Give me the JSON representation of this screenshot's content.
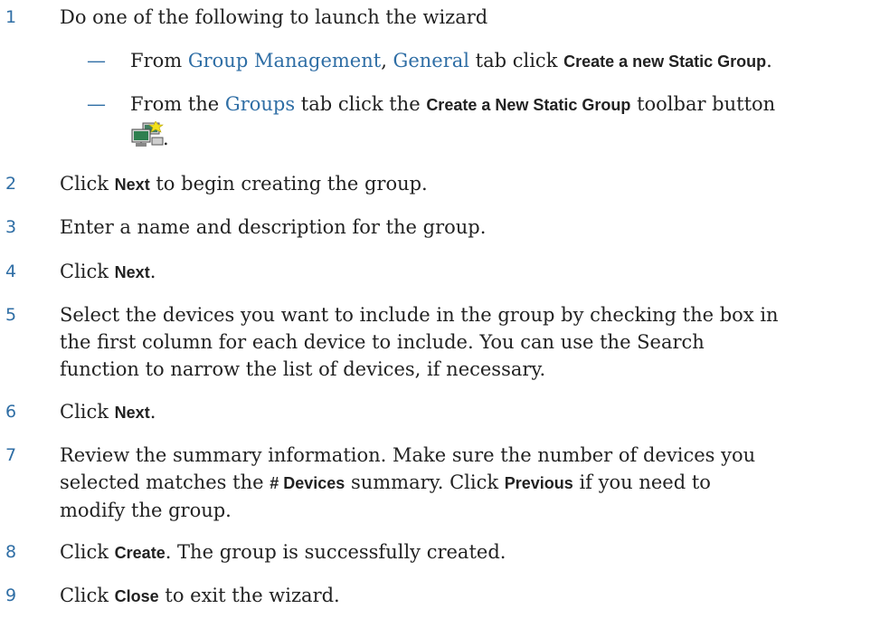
{
  "steps": [
    {
      "num": "1",
      "text": "Do one of the following to launch the wizard"
    },
    {
      "num": "2",
      "pre": "Click ",
      "bold": "Next",
      "post": " to begin creating the group."
    },
    {
      "num": "3",
      "text": "Enter a name and description for the group."
    },
    {
      "num": "4",
      "pre": "Click ",
      "bold": "Next",
      "post": "."
    },
    {
      "num": "5",
      "line1": "Select the devices you want to include in the group by checking the box in",
      "line2": "the first column for each device to include. You can use the Search",
      "line3": "function to narrow the list of devices, if necessary."
    },
    {
      "num": "6",
      "pre": "Click ",
      "bold": "Next",
      "post": "."
    },
    {
      "num": "7",
      "line1_pre": "Review the summary information. Make sure the number of devices you",
      "line2_pre": "selected matches the ",
      "line2_bold": "# Devices",
      "line2_mid": " summary. Click ",
      "line2_bold2": "Previous",
      "line2_post": " if you need to",
      "line3": "modify the group."
    },
    {
      "num": "8",
      "pre": "Click ",
      "bold": "Create",
      "post": ". The group is successfully created."
    },
    {
      "num": "9",
      "pre": "Click ",
      "bold": "Close",
      "post": " to exit the wizard."
    }
  ],
  "sub1": {
    "dash": "—",
    "pre": "From ",
    "link1": "Group Management",
    "sep": ", ",
    "link2": "General",
    "mid": " tab click ",
    "bold": "Create a new Static Group",
    "post": "."
  },
  "sub2": {
    "dash": "—",
    "pre": "From the ",
    "link1": "Groups",
    "mid": " tab click the ",
    "bold": "Create a New Static Group",
    "post": " toolbar button",
    "period": "."
  },
  "icon": "computer-network-group-icon",
  "colors": {
    "accent": "#2f6ea5",
    "text": "#222222"
  }
}
